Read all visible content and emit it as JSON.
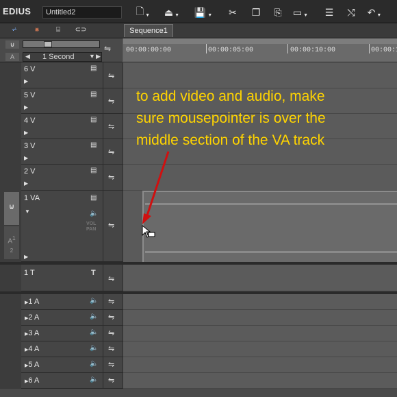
{
  "app": {
    "logo": "EDIUS",
    "project_name": "Untitled2"
  },
  "sequence_tab": "Sequence1",
  "timescale": {
    "label": "1 Second"
  },
  "timecodes": [
    "00:00:00:00",
    "00:00:05:00",
    "00:00:10:00",
    "00:00:1"
  ],
  "video_tracks": [
    {
      "label": "6 V"
    },
    {
      "label": "5 V"
    },
    {
      "label": "4 V"
    },
    {
      "label": "3 V"
    },
    {
      "label": "2 V"
    }
  ],
  "va_track": {
    "label": "1 VA",
    "vol_label": "VOL",
    "pan_label": "PAN",
    "audio_ch": "A",
    "ch_top": "1",
    "ch_bottom": "2"
  },
  "title_track": {
    "label": "1 T"
  },
  "audio_tracks": [
    {
      "label": "1 A"
    },
    {
      "label": "2 A"
    },
    {
      "label": "3 A"
    },
    {
      "label": "4 A"
    },
    {
      "label": "5 A"
    },
    {
      "label": "6 A"
    }
  ],
  "annotation": {
    "lines": [
      "to add video and audio, make",
      "sure mousepointer is over the",
      "middle section of the VA track"
    ],
    "color": "#ffd400",
    "arrow_color": "#d01010"
  }
}
